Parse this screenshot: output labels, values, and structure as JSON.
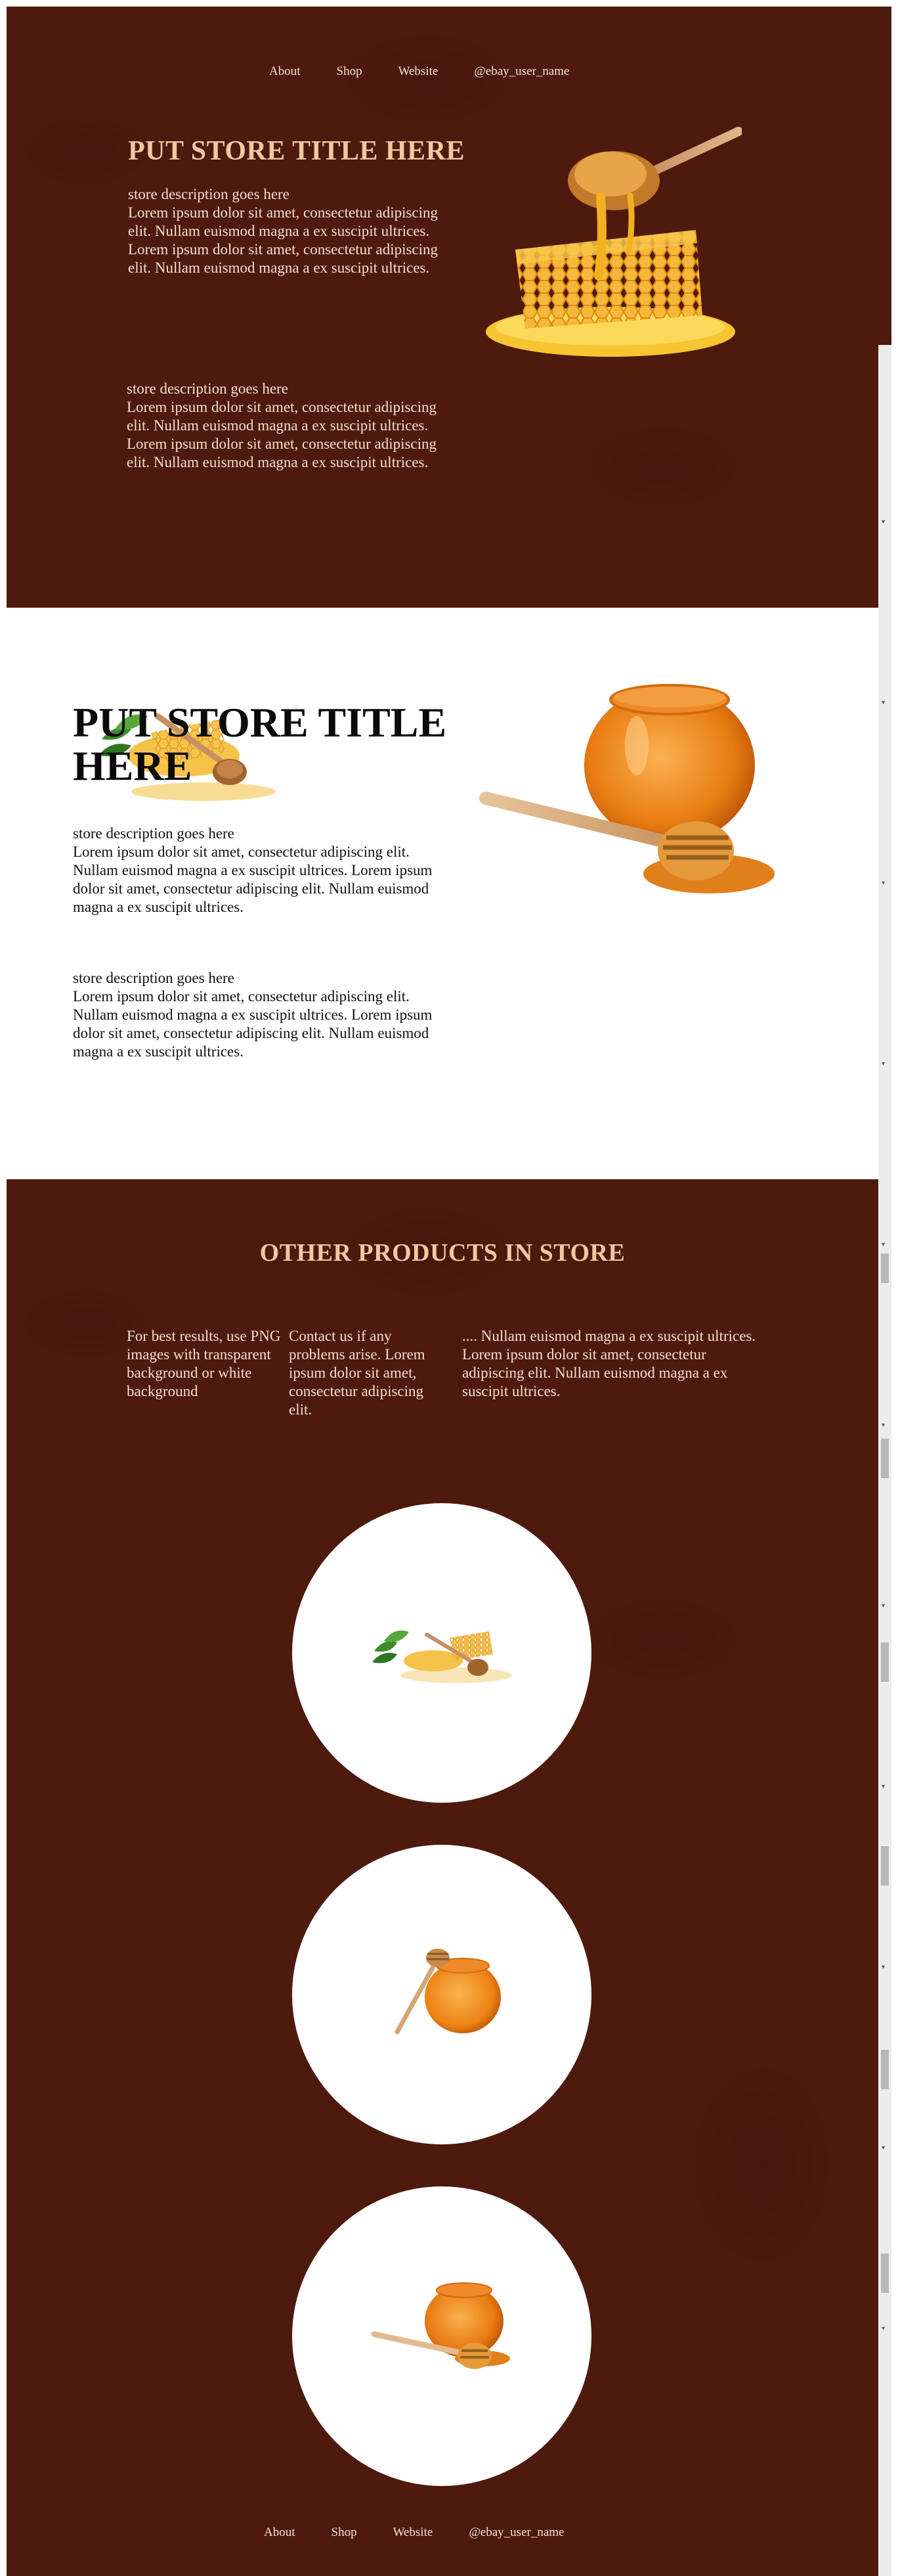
{
  "nav": {
    "about": "About",
    "shop": "Shop",
    "website": "Website",
    "user": "@ebay_user_name"
  },
  "hero": {
    "title": "PUT STORE TITLE HERE",
    "desc1_heading": "store description goes here",
    "desc1_body": "Lorem ipsum dolor sit amet, consectetur adipiscing elit. Nullam euismod magna a ex suscipit ultrices. Lorem ipsum dolor sit amet, consectetur adipiscing elit. Nullam euismod magna a ex suscipit ultrices.",
    "desc2_heading": "store description goes here",
    "desc2_body": "Lorem ipsum dolor sit amet, consectetur adipiscing elit. Nullam euismod magna a ex suscipit ultrices. Lorem ipsum dolor sit amet, consectetur adipiscing elit. Nullam euismod magna a ex suscipit ultrices."
  },
  "section2": {
    "title": "PUT STORE TITLE HERE",
    "desc1_heading": "store description goes here",
    "desc1_body": "Lorem ipsum dolor sit amet, consectetur adipiscing elit. Nullam euismod magna a ex suscipit ultrices. Lorem ipsum dolor sit amet, consectetur adipiscing elit. Nullam euismod magna a ex suscipit ultrices.",
    "desc2_heading": "store description goes here",
    "desc2_body": "Lorem ipsum dolor sit amet, consectetur adipiscing elit. Nullam euismod magna a ex suscipit ultrices. Lorem ipsum dolor sit amet, consectetur adipiscing elit. Nullam euismod magna a ex suscipit ultrices."
  },
  "products": {
    "title": "OTHER PRODUCTS IN STORE",
    "info1": "For best results, use PNG images with transparent background or white background",
    "info2": "Contact us if any problems arise. Lorem ipsum dolor sit amet, consectetur adipiscing elit.",
    "info3": ".... Nullam euismod magna a ex suscipit ultrices. Lorem ipsum dolor sit amet, consectetur adipiscing elit. Nullam euismod magna a ex suscipit ultrices."
  },
  "colors": {
    "background_brown": "#4e1a0d",
    "title_peach": "#f2c7a4",
    "honey": "#f0a020"
  },
  "icons": [
    "honeycomb-image",
    "honey-dipper-image",
    "honey-jar-image",
    "mint-leaf-image"
  ]
}
